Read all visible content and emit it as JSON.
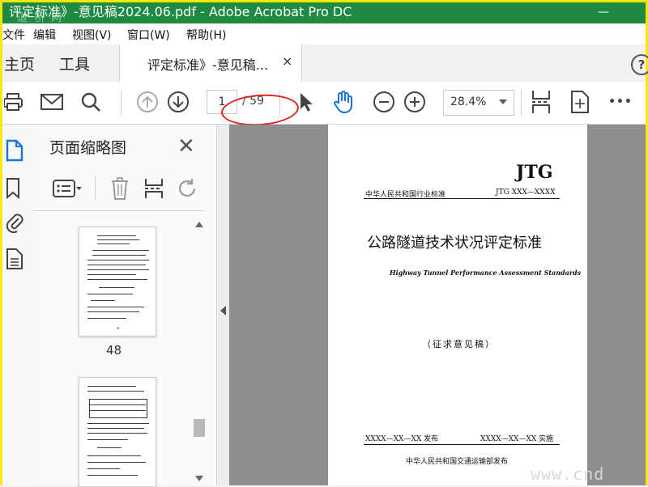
{
  "window": {
    "title": "评定标准》-意见稿2024.06.pdf - Adobe Acrobat Pro DC",
    "watermark": "道 桥 网",
    "minimize": "—"
  },
  "menu": [
    "文件",
    "编辑",
    "视图(V)",
    "窗口(W)",
    "帮助(H)"
  ],
  "tabs": {
    "home": "主页",
    "tools": "工具",
    "document": "评定标准》-意见稿...",
    "close": "×",
    "help": "?"
  },
  "toolbar": {
    "current_page": "1",
    "total_pages": "/ 59",
    "zoom": "28.4%",
    "more": "•••"
  },
  "thumbnails": {
    "title": "页面缩略图",
    "close": "✕",
    "page_number": "48"
  },
  "document": {
    "code": "JTG",
    "std_line": "中华人民共和国行业标准",
    "std_number": "JTG XXX—XXXX",
    "title_cn": "公路隧道技术状况评定标准",
    "title_en": "Highway Tunnel Performance Assessment Standards",
    "draft": "（征求意见稿）",
    "publish": "XXXX—XX—XX 发布",
    "implement": "XXXX—XX—XX 实施",
    "issuer": "中华人民共和国交通运输部发布"
  },
  "page_watermark": "www.cnd",
  "colors": {
    "titlebar": "#1f8a42",
    "accent_blue": "#1a73d9",
    "annotation_red": "#e0241c",
    "frame_yellow": "#f7e80a"
  }
}
